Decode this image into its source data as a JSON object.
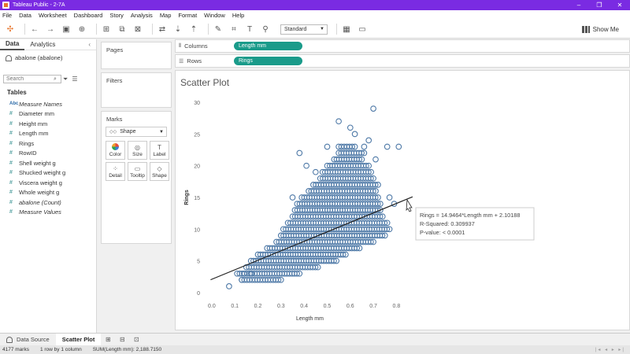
{
  "window": {
    "title": "Tableau Public - 2-7A",
    "brand_color": "#7a2be2"
  },
  "menu": [
    "File",
    "Data",
    "Worksheet",
    "Dashboard",
    "Story",
    "Analysis",
    "Map",
    "Format",
    "Window",
    "Help"
  ],
  "toolbar": {
    "icons": [
      "tableau-logo-icon",
      "undo-icon",
      "redo-icon",
      "save-icon",
      "add-datasource-icon",
      "new-worksheet-icon",
      "duplicate-icon",
      "clear-icon",
      "swap-icon",
      "sort-ascending-icon",
      "sort-descending-icon",
      "highlight-icon",
      "group-icon",
      "label-icon",
      "pin-icon",
      "present-icon"
    ],
    "fit_select": "Standard",
    "show_me": "Show Me"
  },
  "data_pane": {
    "tabs": [
      "Data",
      "Analytics"
    ],
    "datasource": "abalone (abalone)",
    "search_placeholder": "Search",
    "tables_heading": "Tables",
    "fields": [
      {
        "type": "Abc",
        "name": "Measure Names",
        "meta": true
      },
      {
        "type": "#",
        "name": "Diameter mm",
        "meta": false
      },
      {
        "type": "#",
        "name": "Height mm",
        "meta": false
      },
      {
        "type": "#",
        "name": "Length mm",
        "meta": false
      },
      {
        "type": "#",
        "name": "Rings",
        "meta": false
      },
      {
        "type": "#",
        "name": "RowID",
        "meta": false
      },
      {
        "type": "#",
        "name": "Shell weight g",
        "meta": false
      },
      {
        "type": "#",
        "name": "Shucked weight g",
        "meta": false
      },
      {
        "type": "#",
        "name": "Viscera weight g",
        "meta": false
      },
      {
        "type": "#",
        "name": "Whole weight g",
        "meta": false
      },
      {
        "type": "#",
        "name": "abalone (Count)",
        "meta": true
      },
      {
        "type": "#",
        "name": "Measure Values",
        "meta": true
      }
    ]
  },
  "cards": {
    "pages": "Pages",
    "filters": "Filters",
    "marks": "Marks",
    "mark_type": "Shape",
    "mark_buttons": [
      "Color",
      "Size",
      "Label",
      "Detail",
      "Tooltip",
      "Shape"
    ]
  },
  "shelves": {
    "columns_label": "Columns",
    "columns_pill": "Length mm",
    "rows_label": "Rows",
    "rows_pill": "Rings",
    "pill_color": "#1a9b8a"
  },
  "sheet_title": "Scatter Plot",
  "chart_data": {
    "type": "scatter",
    "title": "",
    "xlabel": "Length mm",
    "ylabel": "Rings",
    "xlim": [
      -0.02,
      0.86
    ],
    "ylim": [
      -0.5,
      30.5
    ],
    "x_ticks": [
      0.0,
      0.1,
      0.2,
      0.3,
      0.4,
      0.5,
      0.6,
      0.7,
      0.8
    ],
    "y_ticks": [
      0,
      5,
      10,
      15,
      20,
      25,
      30
    ],
    "grid": false,
    "mark_color": "#4e79a7",
    "points_approx": [
      [
        0.075,
        1
      ],
      [
        0.13,
        2
      ],
      [
        0.14,
        3
      ],
      [
        0.17,
        3
      ],
      [
        0.35,
        15
      ],
      [
        0.38,
        22
      ],
      [
        0.45,
        19
      ],
      [
        0.55,
        27
      ],
      [
        0.6,
        26
      ],
      [
        0.62,
        25
      ],
      [
        0.66,
        23
      ],
      [
        0.68,
        24
      ],
      [
        0.7,
        29
      ],
      [
        0.76,
        23
      ],
      [
        0.81,
        23
      ],
      [
        0.79,
        14
      ],
      [
        0.77,
        15
      ],
      [
        0.71,
        21
      ],
      [
        0.5,
        23
      ],
      [
        0.41,
        20
      ]
    ],
    "trend_line": {
      "slope": 14.9464,
      "intercept": 2.10188,
      "x_from": -0.005,
      "x_to": 0.87
    },
    "tooltip": [
      "Rings = 14.9464*Length mm + 2.10188",
      "R-Squared: 0.309937",
      "P-value: < 0.0001"
    ]
  },
  "sheet_tabs": {
    "datasource": "Data Source",
    "active": "Scatter Plot",
    "new_icons": [
      "new-worksheet-tab-icon",
      "new-dashboard-tab-icon",
      "new-story-tab-icon"
    ]
  },
  "status": {
    "marks": "4177 marks",
    "grid": "1 row by 1 column",
    "sum": "SUM(Length mm): 2,188.7150"
  }
}
